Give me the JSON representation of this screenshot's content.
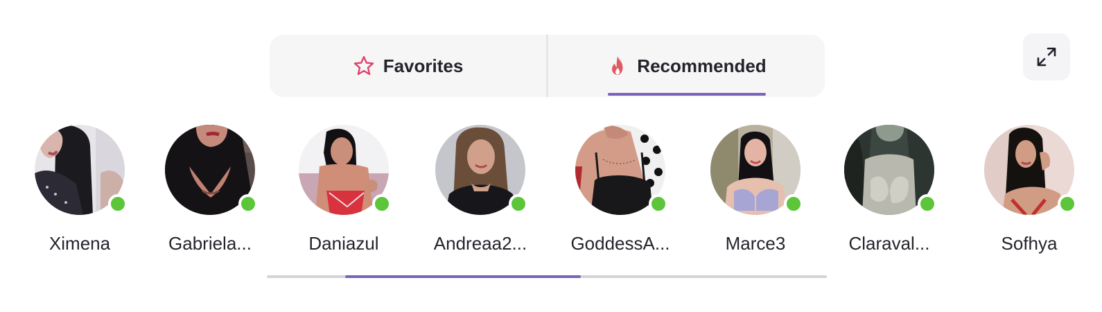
{
  "tabs": [
    {
      "label": "Favorites",
      "icon": "star-icon",
      "active": false
    },
    {
      "label": "Recommended",
      "icon": "flame-icon",
      "active": true
    }
  ],
  "expand_button": {
    "icon": "expand-icon"
  },
  "colors": {
    "accent": "#7a63bb",
    "star": "#e0426b",
    "flame": "#e05a63",
    "online": "#5cc53a"
  },
  "avatars": [
    {
      "name": "Ximena",
      "online": true
    },
    {
      "name": "Gabriela...",
      "online": true
    },
    {
      "name": "Daniazul",
      "online": true
    },
    {
      "name": "Andreaa2...",
      "online": true
    },
    {
      "name": "GoddessA...",
      "online": true
    },
    {
      "name": "Marce3",
      "online": true
    },
    {
      "name": "Claraval...",
      "online": true
    },
    {
      "name": "Sofhya",
      "online": true
    }
  ],
  "scroll_position": 0.25
}
